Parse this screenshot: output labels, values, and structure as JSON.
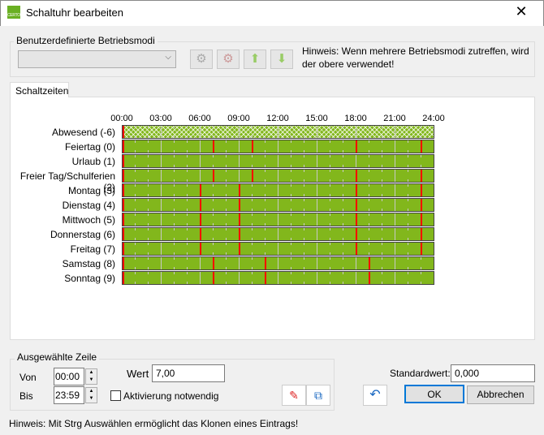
{
  "window": {
    "title": "Schaltuhr bearbeiten",
    "icon_text": "CERTO"
  },
  "modes": {
    "group_label": "Benutzerdefinierte Betriebsmodi",
    "selected": "",
    "hint": "Hinweis: Wenn mehrere Betriebsmodi zutreffen, wird der obere verwendet!"
  },
  "tabs": [
    {
      "label": "Schaltzeiten"
    }
  ],
  "schedule": {
    "hours": [
      "00:00",
      "03:00",
      "06:00",
      "09:00",
      "12:00",
      "15:00",
      "18:00",
      "21:00",
      "24:00"
    ],
    "rows": [
      {
        "label": "Abwesend (-6)",
        "hatched": true,
        "switch_hours": [
          0
        ]
      },
      {
        "label": "Feiertag (0)",
        "switch_hours": [
          0,
          7,
          10,
          18,
          23
        ]
      },
      {
        "label": "Urlaub (1)",
        "switch_hours": [
          0
        ]
      },
      {
        "label": "Freier Tag/Schulferien (2)",
        "switch_hours": [
          0,
          7,
          10,
          18,
          23
        ]
      },
      {
        "label": "Montag (3)",
        "switch_hours": [
          0,
          6,
          9,
          18,
          23
        ]
      },
      {
        "label": "Dienstag (4)",
        "switch_hours": [
          0,
          6,
          9,
          18,
          23
        ]
      },
      {
        "label": "Mittwoch (5)",
        "switch_hours": [
          0,
          6,
          9,
          18,
          23
        ]
      },
      {
        "label": "Donnerstag (6)",
        "switch_hours": [
          0,
          6,
          9,
          18,
          23
        ]
      },
      {
        "label": "Freitag (7)",
        "switch_hours": [
          0,
          6,
          9,
          18,
          23
        ]
      },
      {
        "label": "Samstag (8)",
        "switch_hours": [
          0,
          7,
          11,
          19
        ]
      },
      {
        "label": "Sonntag (9)",
        "switch_hours": [
          0,
          7,
          11,
          19
        ]
      }
    ],
    "colors": {
      "bar": "#82b71c",
      "switch": "#ff0000"
    }
  },
  "selected_row": {
    "group_label": "Ausgewählte Zeile",
    "von_label": "Von",
    "von": "00:00",
    "bis_label": "Bis",
    "bis": "23:59",
    "wert_label": "Wert",
    "wert": "7,00",
    "activation_label": "Aktivierung notwendig",
    "activation_checked": false
  },
  "standard": {
    "label": "Standardwert:",
    "value": "0,000"
  },
  "buttons": {
    "ok": "OK",
    "cancel": "Abbrechen"
  },
  "footer_hint": "Hinweis: Mit Strg Auswählen ermöglicht das Klonen eines Eintrags!"
}
